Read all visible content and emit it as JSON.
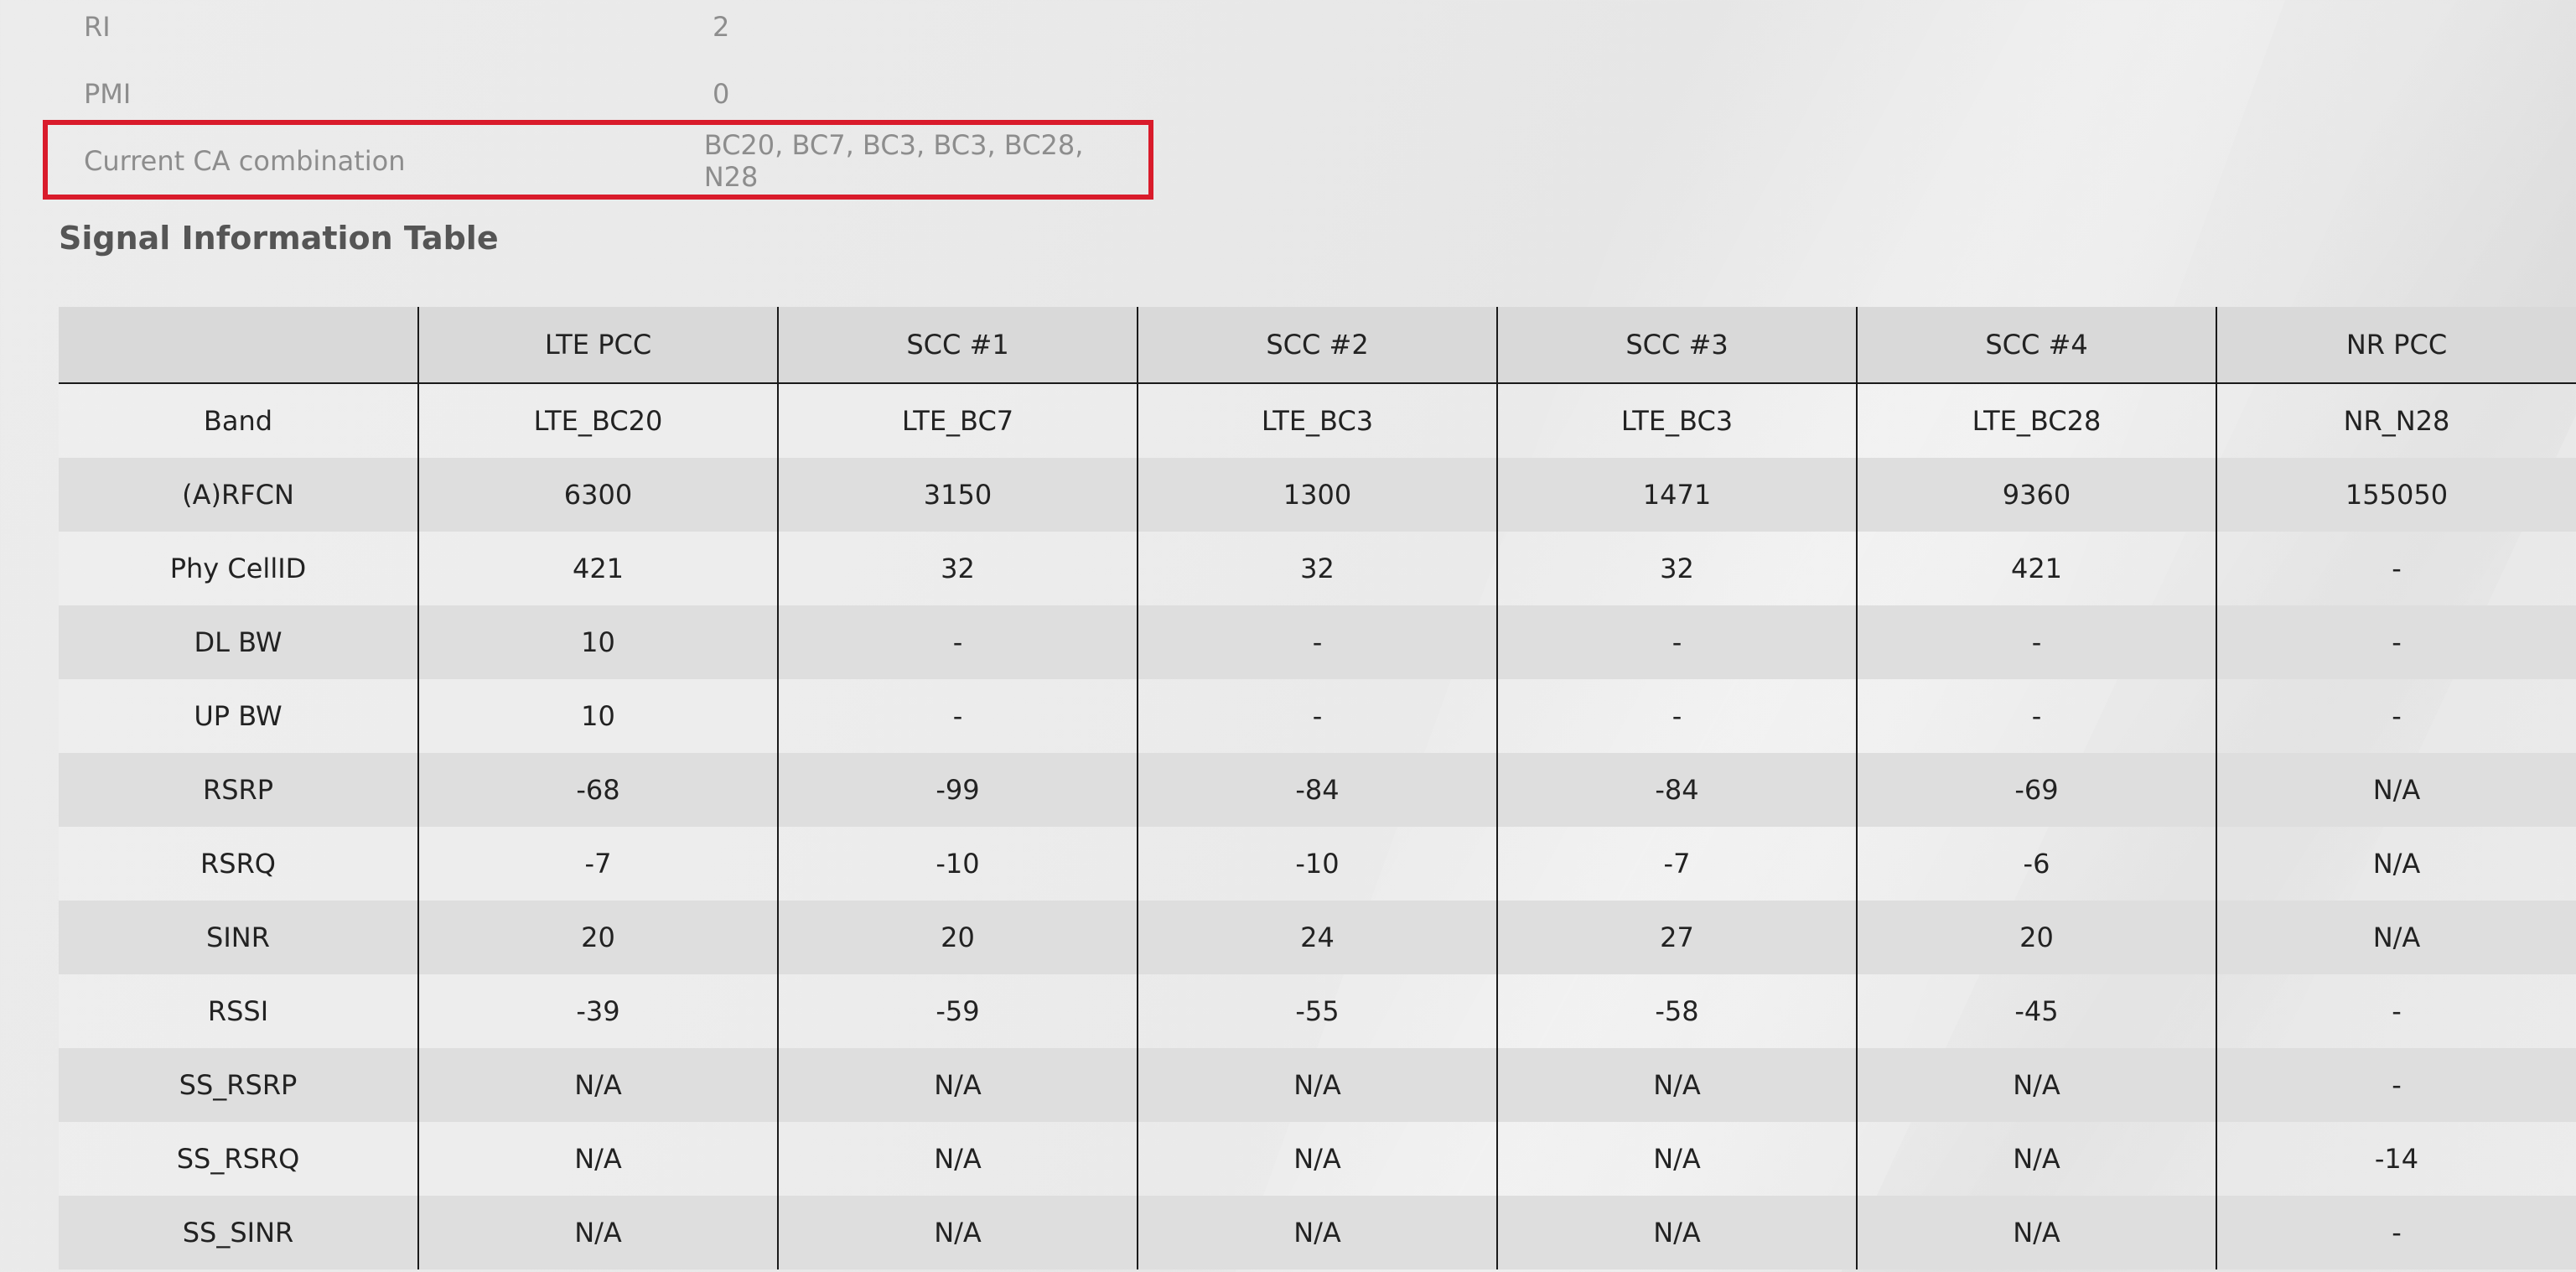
{
  "info": [
    {
      "label": "RI",
      "value": "2"
    },
    {
      "label": "PMI",
      "value": "0"
    },
    {
      "label": "Current CA combination",
      "value": "BC20, BC7, BC3, BC3, BC28, N28"
    }
  ],
  "section_title": "Signal Information Table",
  "table": {
    "headers": [
      "",
      "LTE PCC",
      "SCC #1",
      "SCC #2",
      "SCC #3",
      "SCC #4",
      "NR PCC"
    ],
    "rows": [
      [
        "Band",
        "LTE_BC20",
        "LTE_BC7",
        "LTE_BC3",
        "LTE_BC3",
        "LTE_BC28",
        "NR_N28"
      ],
      [
        "(A)RFCN",
        "6300",
        "3150",
        "1300",
        "1471",
        "9360",
        "155050"
      ],
      [
        "Phy CellID",
        "421",
        "32",
        "32",
        "32",
        "421",
        "-"
      ],
      [
        "DL BW",
        "10",
        "-",
        "-",
        "-",
        "-",
        "-"
      ],
      [
        "UP BW",
        "10",
        "-",
        "-",
        "-",
        "-",
        "-"
      ],
      [
        "RSRP",
        "-68",
        "-99",
        "-84",
        "-84",
        "-69",
        "N/A"
      ],
      [
        "RSRQ",
        "-7",
        "-10",
        "-10",
        "-7",
        "-6",
        "N/A"
      ],
      [
        "SINR",
        "20",
        "20",
        "24",
        "27",
        "20",
        "N/A"
      ],
      [
        "RSSI",
        "-39",
        "-59",
        "-55",
        "-58",
        "-45",
        "-"
      ],
      [
        "SS_RSRP",
        "N/A",
        "N/A",
        "N/A",
        "N/A",
        "N/A",
        "-"
      ],
      [
        "SS_RSRQ",
        "N/A",
        "N/A",
        "N/A",
        "N/A",
        "N/A",
        "-14"
      ],
      [
        "SS_SINR",
        "N/A",
        "N/A",
        "N/A",
        "N/A",
        "N/A",
        "-"
      ]
    ]
  },
  "colors": {
    "highlight": "#d91b2b",
    "header_bg": "#d9d9d9"
  }
}
